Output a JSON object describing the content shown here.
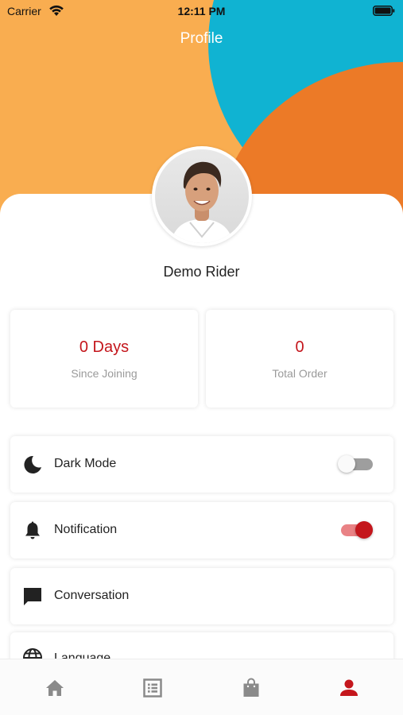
{
  "status_bar": {
    "carrier": "Carrier",
    "time": "12:11 PM"
  },
  "header": {
    "title": "Profile"
  },
  "user": {
    "name": "Demo Rider"
  },
  "stats": [
    {
      "value": "0 Days",
      "label": "Since Joining"
    },
    {
      "value": "0",
      "label": "Total Order"
    }
  ],
  "menu": [
    {
      "label": "Dark Mode",
      "icon": "moon-icon",
      "toggle": false
    },
    {
      "label": "Notification",
      "icon": "bell-icon",
      "toggle": true
    },
    {
      "label": "Conversation",
      "icon": "chat-icon"
    },
    {
      "label": "Language",
      "icon": "globe-icon"
    }
  ],
  "bottom_nav": [
    {
      "name": "home",
      "icon": "home-icon",
      "active": false
    },
    {
      "name": "orders",
      "icon": "list-icon",
      "active": false
    },
    {
      "name": "shop",
      "icon": "shopping-bag-icon",
      "active": false
    },
    {
      "name": "profile",
      "icon": "person-icon",
      "active": true
    }
  ],
  "colors": {
    "accent": "#c4161c",
    "header_yellow": "#f9ad50",
    "header_blue": "#10b3d2",
    "header_orange": "#ec7a27",
    "inactive_icon": "#8a8a8a"
  }
}
